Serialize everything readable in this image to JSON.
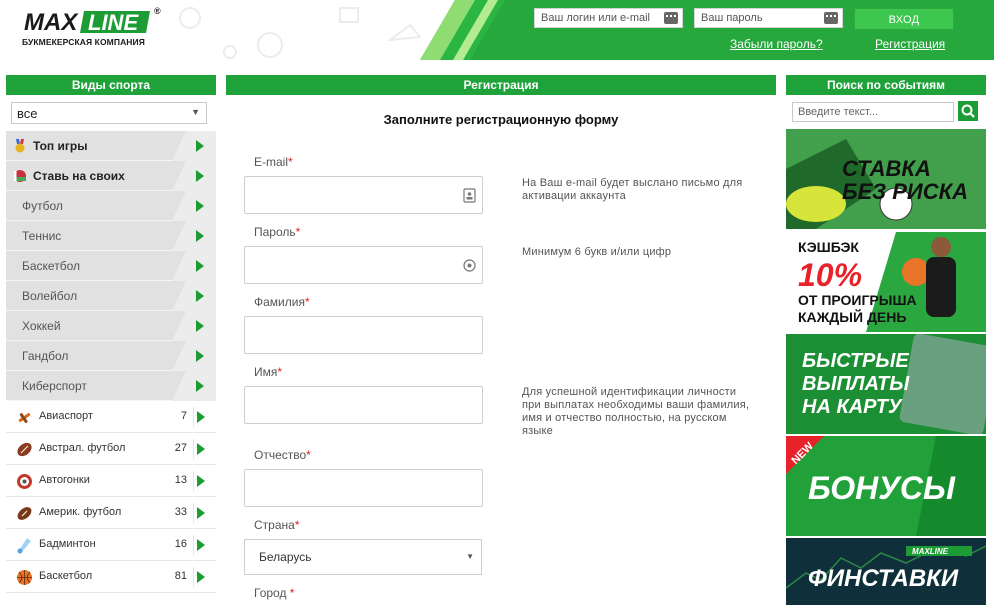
{
  "header": {
    "logo_main": "MAXLINE",
    "logo_tm": "®",
    "logo_sub": "БУКМЕКЕРСКАЯ КОМПАНИЯ",
    "login_placeholder": "Ваш логин или e-mail",
    "password_placeholder": "Ваш пароль",
    "login_button": "ВХОД",
    "forgot_link": "Забыли пароль?",
    "register_link": "Регистрация"
  },
  "sidebar": {
    "title": "Виды спорта",
    "filter_value": "все",
    "top_items": [
      {
        "label": "Топ игры",
        "icon": "medal-icon"
      },
      {
        "label": "Ставь на своих",
        "icon": "belarus-flag-icon"
      }
    ],
    "gray_items": [
      "Футбол",
      "Теннис",
      "Баскетбол",
      "Волейбол",
      "Хоккей",
      "Гандбол",
      "Киберспорт"
    ],
    "sports": [
      {
        "label": "Авиаспорт",
        "count": "7",
        "icon": "plane-icon"
      },
      {
        "label": "Австрал. футбол",
        "count": "27",
        "icon": "aussie-ball-icon"
      },
      {
        "label": "Автогонки",
        "count": "13",
        "icon": "steering-wheel-icon"
      },
      {
        "label": "Америк. футбол",
        "count": "33",
        "icon": "american-football-icon"
      },
      {
        "label": "Бадминтон",
        "count": "16",
        "icon": "shuttlecock-icon"
      },
      {
        "label": "Баскетбол",
        "count": "81",
        "icon": "basketball-icon"
      }
    ]
  },
  "registration": {
    "panel_title": "Регистрация",
    "form_title": "Заполните регистрационную форму",
    "required_mark": "*",
    "fields": {
      "email": "E-mail",
      "password": "Пароль",
      "surname": "Фамилия",
      "name": "Имя",
      "patronymic": "Отчество",
      "country": "Страна",
      "city": "Город "
    },
    "country_value": "Беларусь",
    "hints": {
      "email": "На Ваш e-mail будет выслано письмо для активации аккаунта",
      "password": "Минимум 6 букв и/или цифр",
      "identity": "Для успешной идентификации личности при выплатах необходимы ваши фамилия, имя и отчество полностью, на русском языке"
    }
  },
  "event_search": {
    "title": "Поиск по событиям",
    "placeholder": "Введите текст..."
  },
  "banners": {
    "b1": [
      "СТАВКА",
      "БЕЗ РИСКА"
    ],
    "b2": [
      "КЭШБЭК",
      "10%",
      "ОТ ПРОИГРЫША",
      "КАЖДЫЙ ДЕНЬ"
    ],
    "b3": [
      "БЫСТРЫЕ",
      "ВЫПЛАТЫ",
      "НА КАРТУ"
    ],
    "b4": [
      "NEW",
      "БОНУСЫ"
    ],
    "b5": [
      "MAXLINE",
      "ФИНСТАВКИ"
    ]
  },
  "colors": {
    "brand_green": "#20a23a",
    "accent_green": "#3ec74f",
    "required_red": "#d22222"
  }
}
